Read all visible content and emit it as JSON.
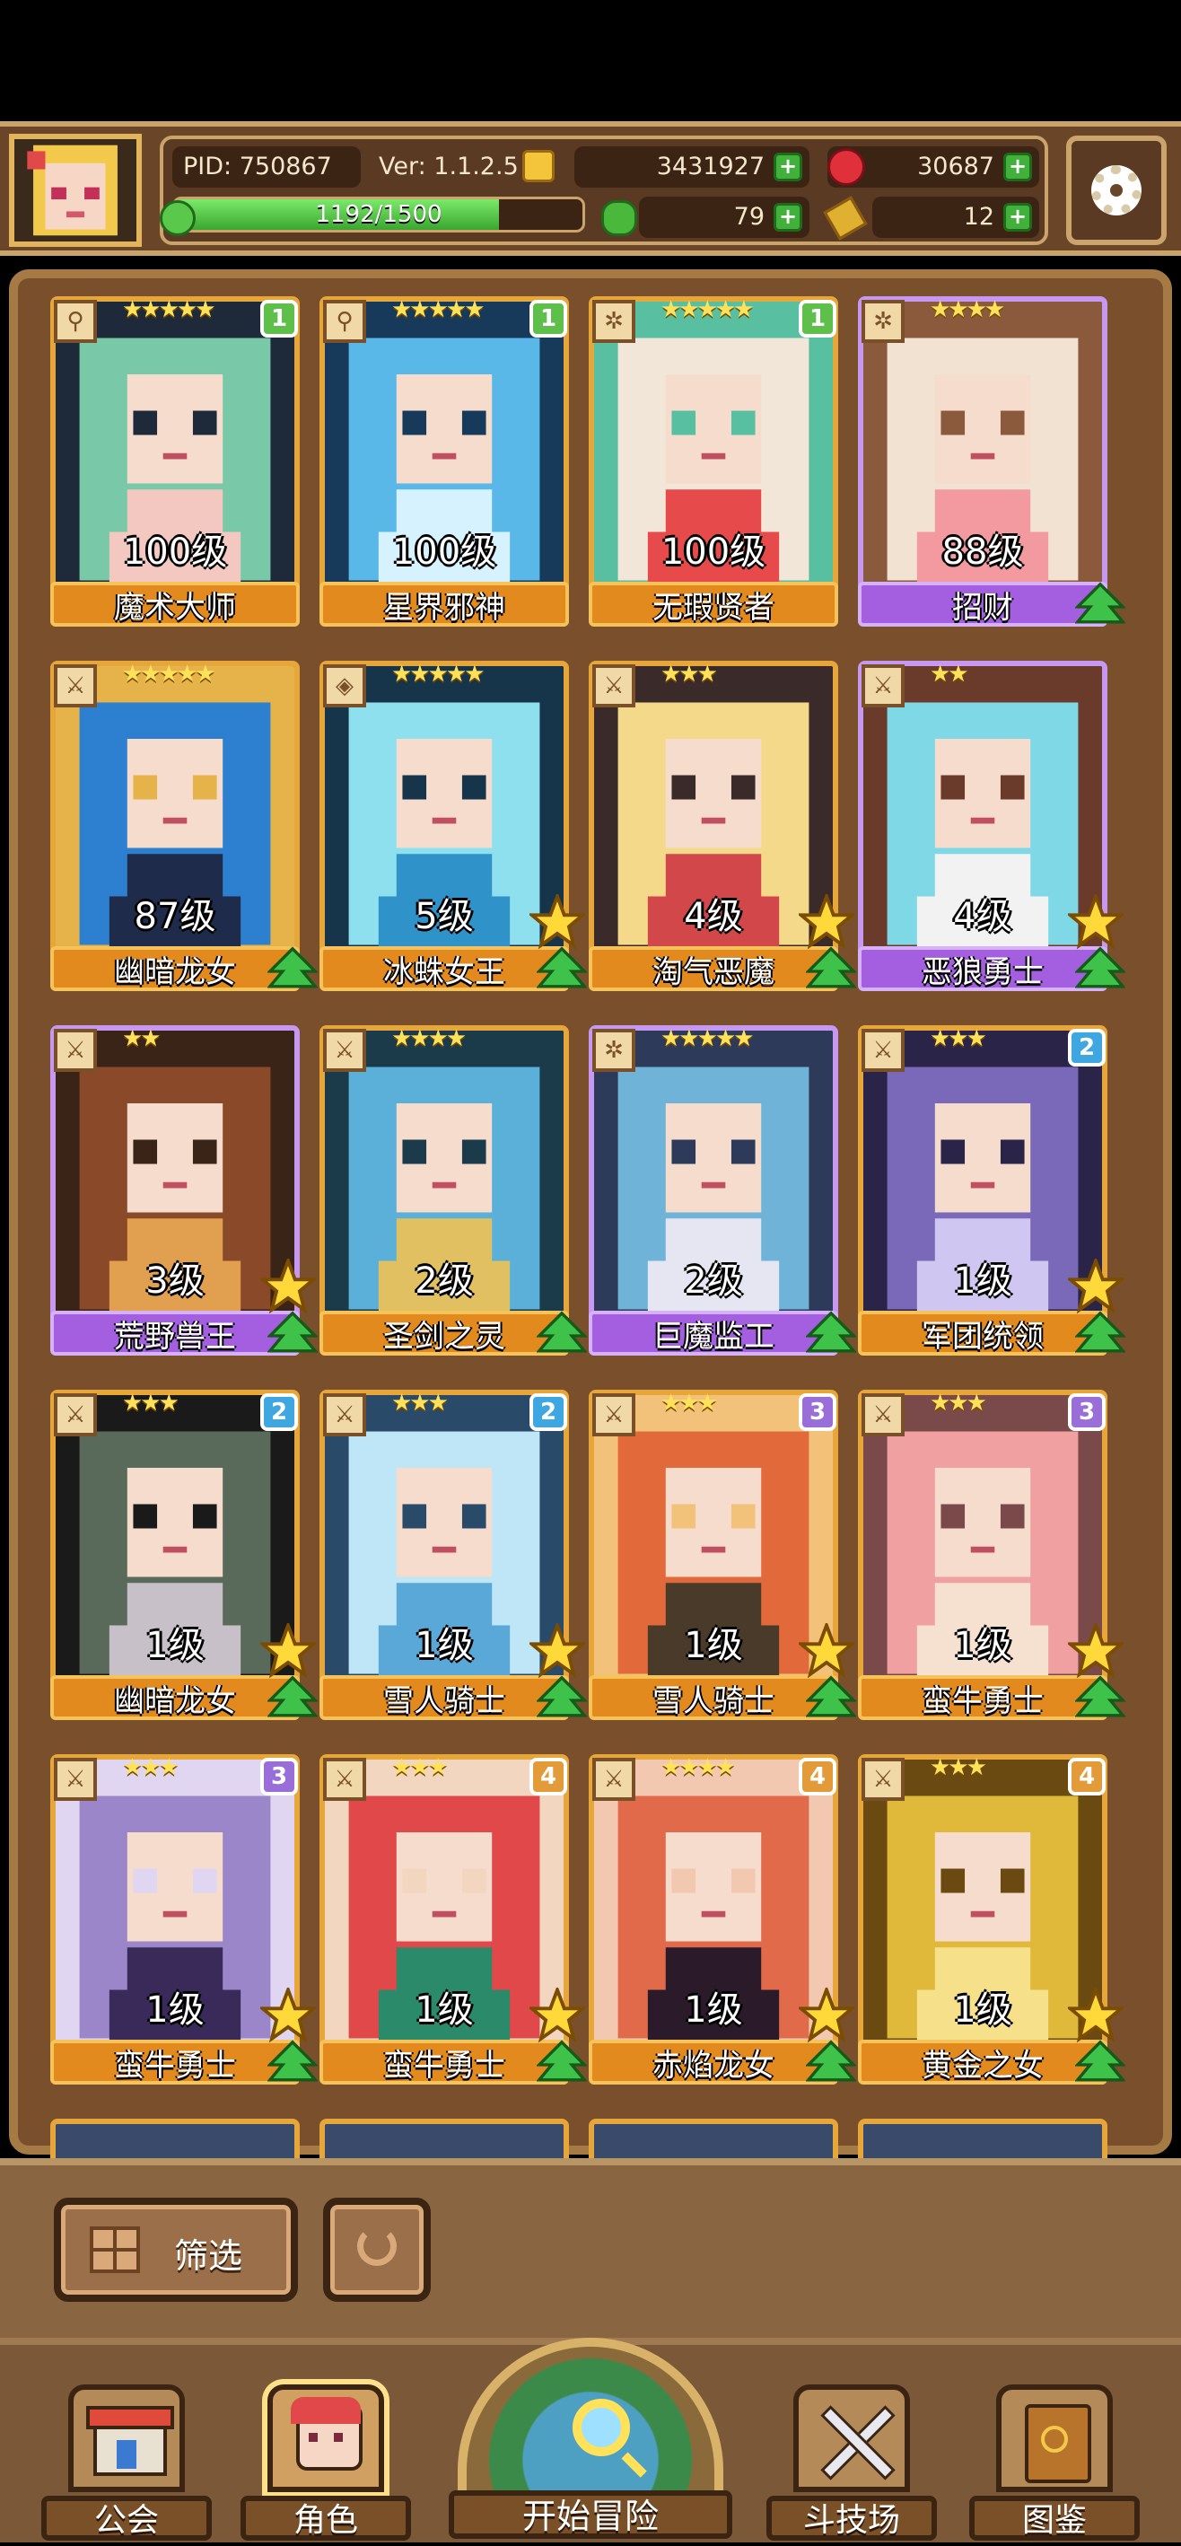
{
  "topbar": {
    "pid": "PID: 750867",
    "version": "Ver: 1.1.2.5",
    "xp_text": "1192/1500",
    "xp_fraction": 0.795,
    "gold": "3431927",
    "gems": "30687",
    "clover": "79",
    "keys": "12",
    "icons": {
      "gold": "gold-coin-icon",
      "gems": "red-gem-icon",
      "clover": "clover-icon",
      "keys": "key-icon",
      "settings": "gear-icon"
    }
  },
  "cards": [
    {
      "name": "魔术大师",
      "level": "100级",
      "stars": "★★★★★",
      "rank": "1",
      "rank_class": "r1",
      "frame": "orange",
      "class_icon": "⚲",
      "palette": [
        "#79c9a8",
        "#f2c8c0",
        "#1e2a3a"
      ],
      "bigstar": false
    },
    {
      "name": "星界邪神",
      "level": "100级",
      "stars": "★★★★★",
      "rank": "1",
      "rank_class": "r1",
      "frame": "orange",
      "class_icon": "⚲",
      "palette": [
        "#59b8e8",
        "#d6f2ff",
        "#173a5a"
      ],
      "bigstar": false
    },
    {
      "name": "无瑕贤者",
      "level": "100级",
      "stars": "★★★★★",
      "rank": "1",
      "rank_class": "r1",
      "frame": "orange",
      "class_icon": "✲",
      "palette": [
        "#f1e6d7",
        "#e64a4a",
        "#58c0a0"
      ],
      "bigstar": false
    },
    {
      "name": "招财",
      "level": "88级",
      "stars": "★★★★",
      "rank": "",
      "rank_class": "",
      "frame": "purple",
      "class_icon": "✲",
      "palette": [
        "#f2e2d2",
        "#f29aa0",
        "#8b5a3c"
      ],
      "bigstar": false
    },
    {
      "name": "幽暗龙女",
      "level": "87级",
      "stars": "★★★★★",
      "rank": "",
      "rank_class": "",
      "frame": "orange",
      "class_icon": "⚔",
      "palette": [
        "#2d7fd0",
        "#1e2b4a",
        "#e6b34a"
      ],
      "bigstar": false
    },
    {
      "name": "冰蛛女王",
      "level": "5级",
      "stars": "★★★★★",
      "rank": "",
      "rank_class": "",
      "frame": "orange",
      "class_icon": "◈",
      "palette": [
        "#8fe0ee",
        "#2f92c8",
        "#17354a"
      ],
      "bigstar": true
    },
    {
      "name": "淘气恶魔",
      "level": "4级",
      "stars": "★★★",
      "rank": "",
      "rank_class": "",
      "frame": "orange",
      "class_icon": "⚔",
      "palette": [
        "#f5d98a",
        "#d2484a",
        "#3b2a2a"
      ],
      "bigstar": true
    },
    {
      "name": "恶狼勇士",
      "level": "4级",
      "stars": "★★",
      "rank": "",
      "rank_class": "",
      "frame": "purple",
      "class_icon": "⚔",
      "palette": [
        "#7fd8e6",
        "#f2f2f2",
        "#6a3a2a"
      ],
      "bigstar": true
    },
    {
      "name": "荒野兽王",
      "level": "3级",
      "stars": "★★",
      "rank": "",
      "rank_class": "",
      "frame": "purple",
      "class_icon": "⚔",
      "palette": [
        "#8a4a2a",
        "#e0a050",
        "#3a2418"
      ],
      "bigstar": true
    },
    {
      "name": "圣剑之灵",
      "level": "2级",
      "stars": "★★★★",
      "rank": "",
      "rank_class": "",
      "frame": "orange",
      "class_icon": "⚔",
      "palette": [
        "#5ab0d8",
        "#e0c060",
        "#1b3a4a"
      ],
      "bigstar": false
    },
    {
      "name": "巨魔监工",
      "level": "2级",
      "stars": "★★★★★",
      "rank": "",
      "rank_class": "",
      "frame": "purple",
      "class_icon": "✲",
      "palette": [
        "#6fb4d8",
        "#e6e6f2",
        "#2e3a5a"
      ],
      "bigstar": false
    },
    {
      "name": "军团统领",
      "level": "1级",
      "stars": "★★★",
      "rank": "2",
      "rank_class": "r2",
      "frame": "orange",
      "class_icon": "⚔",
      "palette": [
        "#7a68b8",
        "#cfc6f2",
        "#2a2448"
      ],
      "bigstar": true
    },
    {
      "name": "幽暗龙女",
      "level": "1级",
      "stars": "★★★",
      "rank": "2",
      "rank_class": "r2",
      "frame": "orange",
      "class_icon": "⚔",
      "palette": [
        "#5a6a5a",
        "#c8c0c8",
        "#1a1a1a"
      ],
      "bigstar": true
    },
    {
      "name": "雪人骑士",
      "level": "1级",
      "stars": "★★★",
      "rank": "2",
      "rank_class": "r2",
      "frame": "orange",
      "class_icon": "⚔",
      "palette": [
        "#bfe6f6",
        "#5aa8d8",
        "#2a4a6a"
      ],
      "bigstar": true
    },
    {
      "name": "雪人骑士",
      "level": "1级",
      "stars": "★★★",
      "rank": "3",
      "rank_class": "r3",
      "frame": "orange",
      "class_icon": "⚔",
      "palette": [
        "#e26a3a",
        "#4a3a2a",
        "#f2c27a"
      ],
      "bigstar": true
    },
    {
      "name": "蛮牛勇士",
      "level": "1级",
      "stars": "★★★",
      "rank": "3",
      "rank_class": "r3",
      "frame": "orange",
      "class_icon": "⚔",
      "palette": [
        "#f0a0a0",
        "#f6e0d0",
        "#7a4a4a"
      ],
      "bigstar": true
    },
    {
      "name": "蛮牛勇士",
      "level": "1级",
      "stars": "★★★",
      "rank": "3",
      "rank_class": "r3",
      "frame": "orange",
      "class_icon": "⚔",
      "palette": [
        "#9a86c8",
        "#3a2a5a",
        "#e0d6f2"
      ],
      "bigstar": true
    },
    {
      "name": "蛮牛勇士",
      "level": "1级",
      "stars": "★★★",
      "rank": "4",
      "rank_class": "r4",
      "frame": "orange",
      "class_icon": "⚔",
      "palette": [
        "#e0484a",
        "#2a8a6a",
        "#f2d6c0"
      ],
      "bigstar": true
    },
    {
      "name": "赤焰龙女",
      "level": "1级",
      "stars": "★★★★",
      "rank": "4",
      "rank_class": "r4",
      "frame": "orange",
      "class_icon": "⚔",
      "palette": [
        "#e06a4a",
        "#2a1a2a",
        "#f2c8b0"
      ],
      "bigstar": true
    },
    {
      "name": "黄金之女",
      "level": "1级",
      "stars": "★★★",
      "rank": "4",
      "rank_class": "r4",
      "frame": "orange",
      "class_icon": "⚔",
      "palette": [
        "#e0b83a",
        "#f6e08a",
        "#6a4a10"
      ],
      "bigstar": true
    }
  ],
  "toolbar": {
    "filter_label": "筛选",
    "filter_icon": "grid-icon",
    "refresh_icon": "refresh-icon"
  },
  "nav": {
    "guild": "公会",
    "character": "角色",
    "adventure": "开始冒险",
    "arena": "斗技场",
    "codex": "图鉴"
  }
}
